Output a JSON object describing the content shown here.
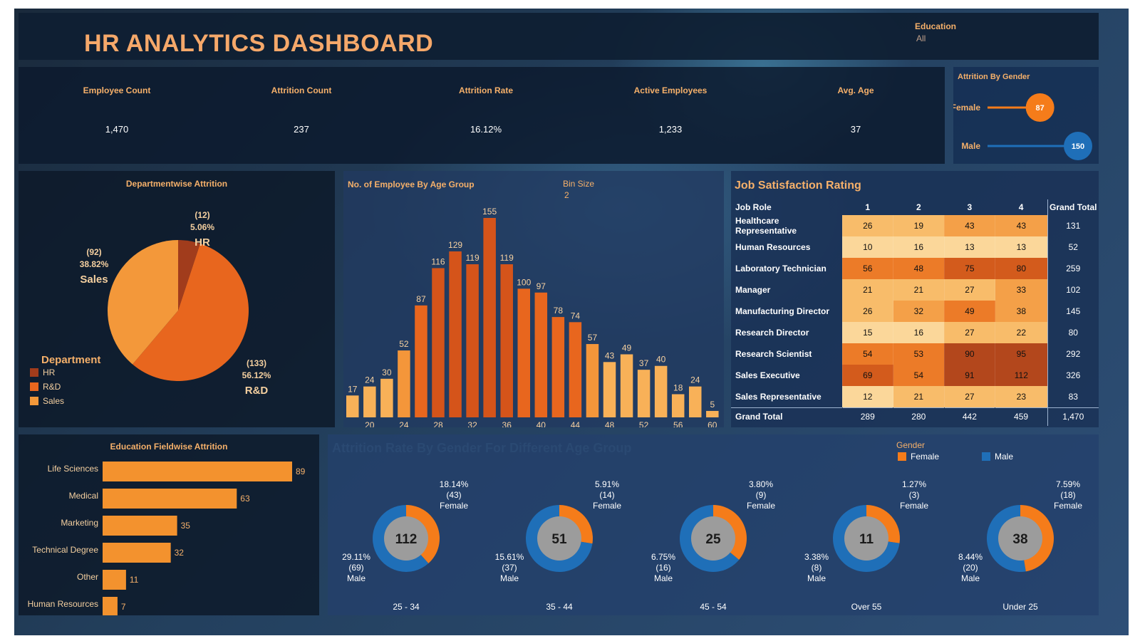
{
  "header": {
    "title": "HR ANALYTICS DASHBOARD",
    "filter_label": "Education",
    "filter_value": "All"
  },
  "kpis": [
    {
      "label": "Employee Count",
      "value": "1,470"
    },
    {
      "label": "Attrition Count",
      "value": "237"
    },
    {
      "label": "Attrition Rate",
      "value": "16.12%"
    },
    {
      "label": "Active Employees",
      "value": "1,233"
    },
    {
      "label": "Avg. Age",
      "value": "37"
    }
  ],
  "gender_panel": {
    "title": "Attrition By Gender",
    "rows": [
      {
        "label": "Female",
        "value": 87,
        "value_text": "87"
      },
      {
        "label": "Male",
        "value": 150,
        "value_text": "150"
      }
    ]
  },
  "colors": {
    "hr": "#a13c1c",
    "rnd": "#e8661e",
    "sales": "#f3983a",
    "female": "#f57c1a",
    "male": "#1f6fb8",
    "accent": "#f5b06a"
  },
  "department": {
    "title": "Departmentwise Attrition",
    "legend_title": "Department",
    "legend": [
      "HR",
      "R&D",
      "Sales"
    ]
  },
  "age": {
    "title": "No. of Employee By Age Group",
    "bin_label": "Bin Size",
    "bin_value": "2"
  },
  "satisfaction": {
    "title": "Job Satisfaction Rating",
    "headers": [
      "Job Role",
      "1",
      "2",
      "3",
      "4",
      "Grand Total"
    ],
    "rows": [
      {
        "role": "Healthcare Representative",
        "vals": [
          26,
          19,
          43,
          43
        ],
        "total": "131"
      },
      {
        "role": "Human Resources",
        "vals": [
          10,
          16,
          13,
          13
        ],
        "total": "52"
      },
      {
        "role": "Laboratory Technician",
        "vals": [
          56,
          48,
          75,
          80
        ],
        "total": "259"
      },
      {
        "role": "Manager",
        "vals": [
          21,
          21,
          27,
          33
        ],
        "total": "102"
      },
      {
        "role": "Manufacturing Director",
        "vals": [
          26,
          32,
          49,
          38
        ],
        "total": "145"
      },
      {
        "role": "Research Director",
        "vals": [
          15,
          16,
          27,
          22
        ],
        "total": "80"
      },
      {
        "role": "Research Scientist",
        "vals": [
          54,
          53,
          90,
          95
        ],
        "total": "292"
      },
      {
        "role": "Sales Executive",
        "vals": [
          69,
          54,
          91,
          112
        ],
        "total": "326"
      },
      {
        "role": "Sales Representative",
        "vals": [
          12,
          21,
          27,
          23
        ],
        "total": "83"
      }
    ],
    "total_row": {
      "role": "Grand Total",
      "vals": [
        "289",
        "280",
        "442",
        "459"
      ],
      "total": "1,470"
    }
  },
  "education": {
    "title": "Education Fieldwise Attrition"
  },
  "donuts": {
    "title": "Attrition Rate By Gender For Different Age Group",
    "legend_title": "Gender",
    "legend": [
      "Female",
      "Male"
    ]
  },
  "chart_data": [
    {
      "type": "bar",
      "id": "attrition-by-gender",
      "categories": [
        "Female",
        "Male"
      ],
      "values": [
        87,
        150
      ]
    },
    {
      "type": "pie",
      "id": "department-attrition",
      "title": "Departmentwise Attrition",
      "slices": [
        {
          "name": "HR",
          "value": 12,
          "pct": "5.06%"
        },
        {
          "name": "R&D",
          "value": 133,
          "pct": "56.12%"
        },
        {
          "name": "Sales",
          "value": 92,
          "pct": "38.82%"
        }
      ]
    },
    {
      "type": "bar",
      "id": "employee-by-age-group",
      "title": "No. of Employee By Age Group",
      "x": [
        18,
        20,
        22,
        24,
        26,
        28,
        30,
        32,
        34,
        36,
        38,
        40,
        42,
        44,
        46,
        48,
        50,
        52,
        54,
        56,
        58,
        60
      ],
      "values": [
        17,
        24,
        30,
        52,
        87,
        116,
        129,
        119,
        155,
        119,
        100,
        97,
        78,
        74,
        57,
        43,
        49,
        37,
        40,
        18,
        24,
        5
      ],
      "xticks": [
        20,
        24,
        28,
        32,
        36,
        40,
        44,
        48,
        52,
        56,
        60
      ]
    },
    {
      "type": "heatmap",
      "id": "job-satisfaction",
      "title": "Job Satisfaction Rating"
    },
    {
      "type": "bar",
      "id": "education-field-attrition",
      "title": "Education Fieldwise Attrition",
      "categories": [
        "Life Sciences",
        "Medical",
        "Marketing",
        "Technical Degree",
        "Other",
        "Human Resources"
      ],
      "values": [
        89,
        63,
        35,
        32,
        11,
        7
      ]
    },
    {
      "type": "pie",
      "id": "attrition-gender-age-group",
      "groups": [
        {
          "label": "25 - 34",
          "total": "112",
          "female": 43,
          "female_pct": "18.14%",
          "male": 69,
          "male_pct": "29.11%"
        },
        {
          "label": "35 - 44",
          "total": "51",
          "female": 14,
          "female_pct": "5.91%",
          "male": 37,
          "male_pct": "15.61%"
        },
        {
          "label": "45 - 54",
          "total": "25",
          "female": 9,
          "female_pct": "3.80%",
          "male": 16,
          "male_pct": "6.75%"
        },
        {
          "label": "Over 55",
          "total": "11",
          "female": 3,
          "female_pct": "1.27%",
          "male": 8,
          "male_pct": "3.38%"
        },
        {
          "label": "Under 25",
          "total": "38",
          "female": 18,
          "female_pct": "7.59%",
          "male": 20,
          "male_pct": "8.44%"
        }
      ]
    }
  ]
}
